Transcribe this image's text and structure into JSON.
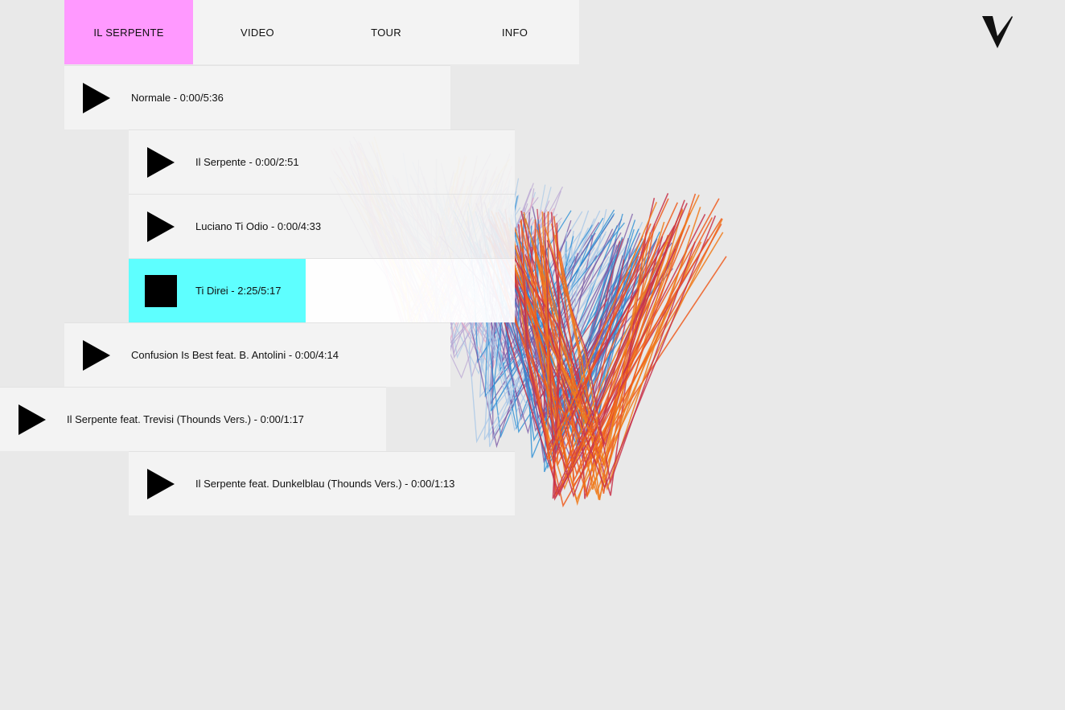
{
  "nav": {
    "items": [
      {
        "label": "IL SERPENTE",
        "active": true
      },
      {
        "label": "VIDEO",
        "active": false
      },
      {
        "label": "TOUR",
        "active": false
      },
      {
        "label": "INFO",
        "active": false
      }
    ],
    "active_color": "#ff99ff"
  },
  "logo": {
    "icon": "v-logo-icon"
  },
  "tracks": [
    {
      "label": "Normale - 0:00/5:36",
      "state": "play"
    },
    {
      "label": "Il Serpente - 0:00/2:51",
      "state": "play"
    },
    {
      "label": "Luciano Ti Odio - 0:00/4:33",
      "state": "play"
    },
    {
      "label": "Ti Direi - 2:25/5:17",
      "state": "playing",
      "progress": 0.458
    },
    {
      "label": "Confusion Is Best feat. B. Antolini - 0:00/4:14",
      "state": "play"
    },
    {
      "label": "Il Serpente feat. Trevisi (Thounds Vers.) - 0:00/1:17",
      "state": "play"
    },
    {
      "label": "Il Serpente feat. Dunkelblau (Thounds Vers.) - 0:00/1:13",
      "state": "play"
    }
  ],
  "colors": {
    "background": "#e9e9e9",
    "panel": "#f3f3f3",
    "playing": "#5effff",
    "art": [
      "#f7d46b",
      "#f3a5c0",
      "#b7a3d1",
      "#a7c7e7",
      "#2a8fd4",
      "#7b5aa6",
      "#c8324a",
      "#ef5a1c",
      "#f07a1a"
    ]
  }
}
